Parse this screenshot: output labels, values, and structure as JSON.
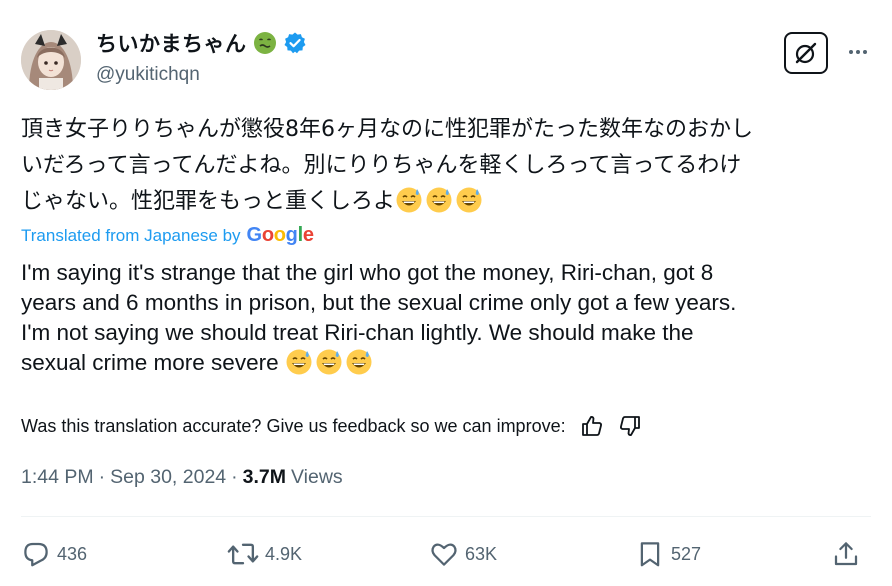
{
  "author": {
    "display_name": "ちいかまちゃん",
    "handle": "@yukitichqn",
    "verified": true
  },
  "post": {
    "text_ja": "頂き女子りりちゃんが懲役8年6ヶ月なのに性犯罪がたった数年なのおかし\nいだろって言ってんだよね。別にりりちゃんを軽くしろって言ってるわけ\nじゃない。性犯罪をもっと重くしろよ",
    "translated_label": "Translated from Japanese by",
    "translator": "Google",
    "text_en": "I'm saying it's strange that the girl who got the money, Riri-chan, got 8\nyears and 6 months in prison, but the sexual crime only got a few years.\nI'm not saying we should treat Riri-chan lightly. We should make the\nsexual crime more severe",
    "feedback_prompt": "Was this translation accurate? Give us feedback so we can improve:",
    "time": "1:44 PM",
    "date": "Sep 30, 2024",
    "views_count": "3.7M",
    "views_label": "Views"
  },
  "actions": {
    "replies": "436",
    "reposts": "4.9K",
    "likes": "63K",
    "bookmarks": "527"
  },
  "colors": {
    "accent": "#1d9bf0",
    "secondary_text": "#536471",
    "nauseated_face": "#7cb342"
  }
}
